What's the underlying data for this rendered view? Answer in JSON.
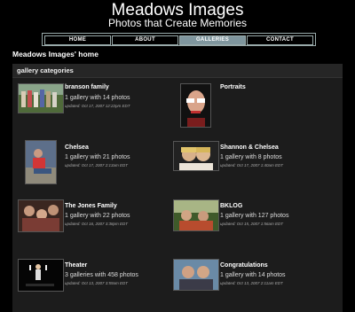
{
  "header": {
    "title": "Meadows Images",
    "subtitle": "Photos that Create Memories"
  },
  "nav": {
    "items": [
      {
        "label": "HOME",
        "active": false
      },
      {
        "label": "ABOUT",
        "active": false
      },
      {
        "label": "GALLERIES",
        "active": true
      },
      {
        "label": "CONTACT",
        "active": false
      }
    ]
  },
  "page": {
    "heading": "Meadows Images' home"
  },
  "categories": {
    "title": "gallery categories",
    "items": [
      {
        "title": "branson family",
        "count": "1 gallery with 14 photos",
        "updated": "updated: Oct 17, 2007 12:22pm EDT"
      },
      {
        "title": "Portraits",
        "count": "",
        "updated": ""
      },
      {
        "title": "Chelsea",
        "count": "1 gallery with 21 photos",
        "updated": "updated: Oct 17, 2007 2:13am EDT"
      },
      {
        "title": "Shannon & Chelsea",
        "count": "1 gallery with 8 photos",
        "updated": "updated: Oct 17, 2007 1:40am EDT"
      },
      {
        "title": "The Jones Family",
        "count": "1 gallery with 22 photos",
        "updated": "updated: Oct 16, 2007 3:38pm EDT"
      },
      {
        "title": "BKLOG",
        "count": "1 gallery with 127 photos",
        "updated": "updated: Oct 15, 2007 1:56am EDT"
      },
      {
        "title": "Theater",
        "count": "3 galleries with 458 photos",
        "updated": "updated: Oct 13, 2007 3:59am EDT"
      },
      {
        "title": "Congratulations",
        "count": "1 gallery with 14 photos",
        "updated": "updated: Oct 13, 2007 2:11am EDT"
      }
    ]
  }
}
